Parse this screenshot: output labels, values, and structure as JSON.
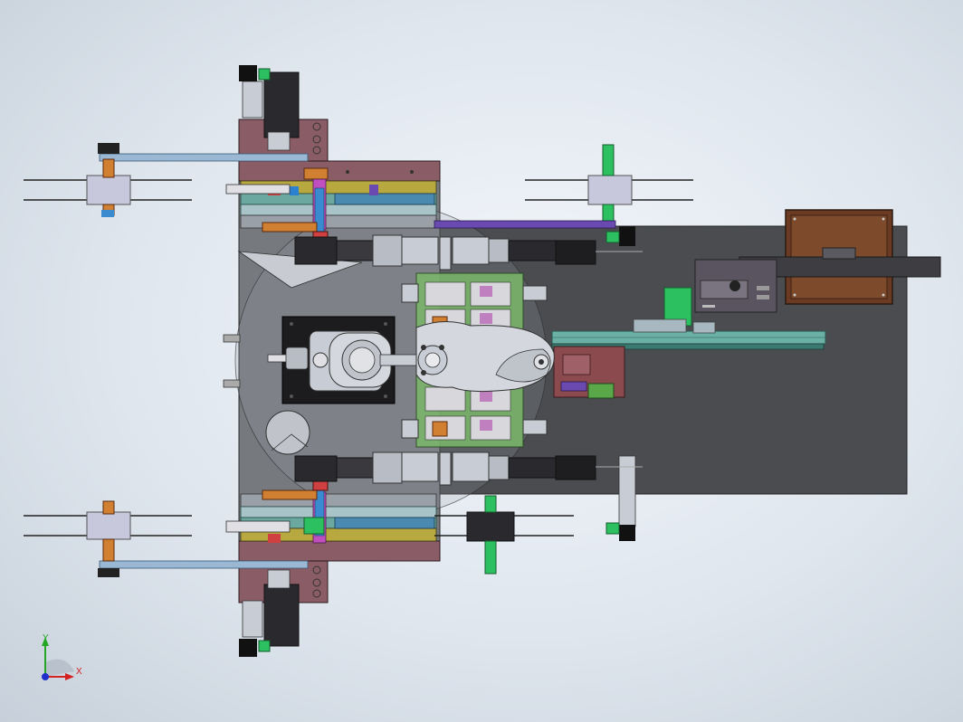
{
  "triad": {
    "x_label": "X",
    "y_label": "Y",
    "x_color": "#d32020",
    "y_color": "#26a626",
    "z_color": "#2030c8"
  },
  "colors": {
    "background": "#dfe6ee",
    "base_plate": "#4a4c50",
    "frame_plate": "#7a7d82",
    "maroon_plate": "#8a5c66",
    "rail_blue": "#4f8fc8",
    "rail_purple": "#6a4ab0",
    "rail_teal": "#6aa8a0",
    "green_block": "#6ab86a",
    "motor_black": "#1e1e20",
    "roller": "#c8c8dc",
    "orange_shaft": "#d08030",
    "control_box": "#8a4a2a"
  }
}
